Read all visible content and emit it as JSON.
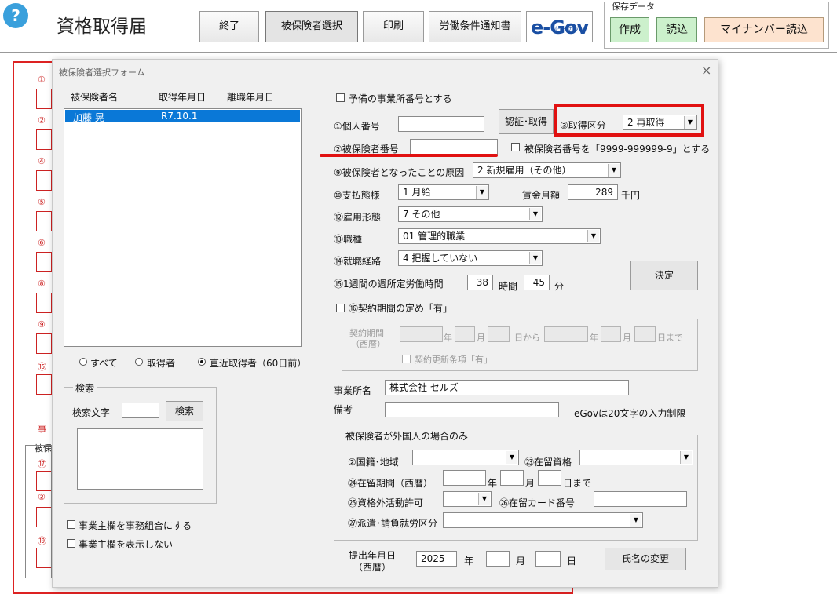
{
  "app": {
    "help": "?",
    "title": "資格取得届",
    "buttons": {
      "exit": "終了",
      "select": "被保険者選択",
      "print": "印刷",
      "notice": "労働条件通知書"
    },
    "egov": {
      "logo": "e-Gov",
      "kana": "(イーガブ)"
    },
    "save": {
      "label": "保存データ",
      "create": "作成",
      "read": "読込",
      "mynumber": "マイナンバー読込"
    }
  },
  "background": {
    "labels": [
      "①",
      "②",
      "④",
      "⑤",
      "⑥",
      "⑧",
      "⑨",
      "⑮",
      "事",
      "被保",
      "⑰",
      "②",
      "⑲"
    ]
  },
  "dialog": {
    "title": "被保険者選択フォーム",
    "close": "×",
    "list": {
      "headers": [
        "被保険者名",
        "取得年月日",
        "離職年月日"
      ],
      "rows": [
        {
          "name": "加藤 晃",
          "acquired": "R7.10.1",
          "left": ""
        }
      ]
    },
    "filter": {
      "all": "すべて",
      "acquirer": "取得者",
      "recent": "直近取得者（60日前）"
    },
    "search": {
      "group": "検索",
      "label": "検索文字",
      "value": "",
      "button": "検索"
    },
    "options": {
      "union": "事業主欄を事務組合にする",
      "hide": "事業主欄を表示しない"
    },
    "spare_office": "予備の事業所番号とする",
    "personal_no": {
      "label": "①個人番号",
      "value": ""
    },
    "auth_button": "認証･取得",
    "acq_type": {
      "label": "③取得区分",
      "value": "2 再取得"
    },
    "insured_no": {
      "label": "②被保険者番号",
      "value": "",
      "check": "被保険者番号を「9999-999999-9」とする"
    },
    "cause": {
      "label": "⑨被保険者となったことの原因",
      "value": "2  新規雇用（その他）"
    },
    "pay": {
      "label": "⑩支払態様",
      "value": "1  月給",
      "wage_label": "賃金月額",
      "wage": "289",
      "wage_unit": "千円"
    },
    "employ": {
      "label": "⑫雇用形態",
      "value": "7  その他"
    },
    "job": {
      "label": "⑬職種",
      "value": "01  管理的職業"
    },
    "route": {
      "label": "⑭就職経路",
      "value": "4  把握していない"
    },
    "hours": {
      "label": "⑮1週間の週所定労働時間",
      "h": "38",
      "h_unit": "時間",
      "m": "45",
      "m_unit": "分"
    },
    "decide": "決定",
    "contract": {
      "check": "⑯契約期間の定め「有」",
      "period_label": [
        "契約期間",
        "（西暦）"
      ],
      "year": "年",
      "month": "月",
      "from": "日から",
      "until": "日まで",
      "renew": "契約更新条項「有」"
    },
    "office": {
      "label": "事業所名",
      "value": "株式会社 セルズ"
    },
    "remarks": {
      "label": "備考",
      "value": "",
      "note": "eGovは20文字の入力制限"
    },
    "foreign": {
      "group": "被保険者が外国人の場合のみ",
      "nation": "②国籍･地域",
      "status": "㉓在留資格",
      "period": "㉔在留期間（西暦）",
      "year": "年",
      "month": "月",
      "until": "日まで",
      "permit": "㉕資格外活動許可",
      "card": "㉖在留カード番号",
      "dispatch": "㉗派遣･請負就労区分"
    },
    "submit": {
      "label": [
        "提出年月日",
        "（西暦）"
      ],
      "year": "2025",
      "y": "年",
      "m": "月",
      "d": "日"
    },
    "rename": "氏名の変更"
  },
  "colors": {
    "highlight": "#e11111",
    "selection": "#0a78d7",
    "underline": "#e11111"
  }
}
